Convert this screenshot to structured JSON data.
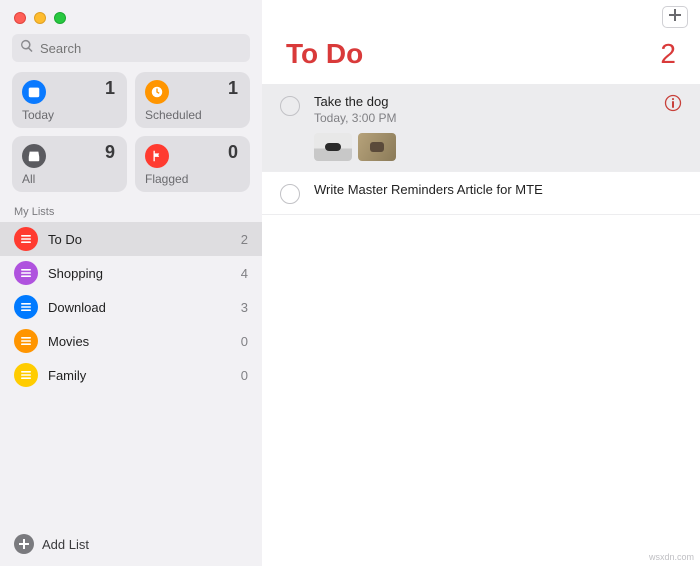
{
  "search": {
    "placeholder": "Search"
  },
  "smart_lists": {
    "today": {
      "label": "Today",
      "count": 1
    },
    "scheduled": {
      "label": "Scheduled",
      "count": 1
    },
    "all": {
      "label": "All",
      "count": 9
    },
    "flagged": {
      "label": "Flagged",
      "count": 0
    }
  },
  "sidebar": {
    "section_label": "My Lists",
    "lists": [
      {
        "label": "To Do",
        "count": 2,
        "color": "c-red",
        "selected": true
      },
      {
        "label": "Shopping",
        "count": 4,
        "color": "c-purple",
        "selected": false
      },
      {
        "label": "Download",
        "count": 3,
        "color": "c-blue",
        "selected": false
      },
      {
        "label": "Movies",
        "count": 0,
        "color": "c-orange",
        "selected": false
      },
      {
        "label": "Family",
        "count": 0,
        "color": "c-yellow",
        "selected": false
      }
    ],
    "add_list_label": "Add List"
  },
  "main": {
    "title": "To Do",
    "count": 2,
    "reminders": [
      {
        "title": "Take the dog",
        "subtitle": "Today, 3:00 PM",
        "selected": true,
        "has_info": true,
        "has_thumbs": true
      },
      {
        "title": "Write Master Reminders Article for MTE",
        "subtitle": "",
        "selected": false,
        "has_info": false,
        "has_thumbs": false
      }
    ]
  },
  "watermark": "wsxdn.com"
}
